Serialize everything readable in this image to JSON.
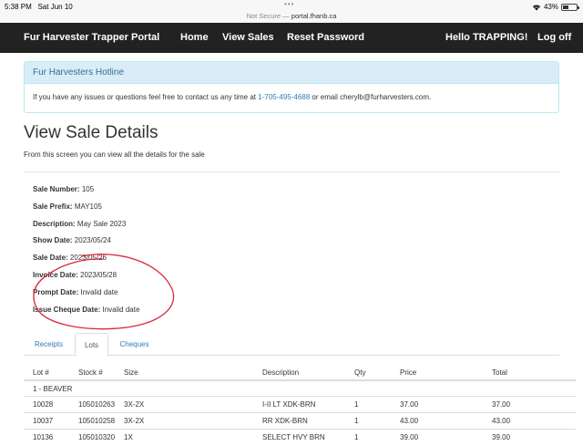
{
  "status_bar": {
    "time": "5:38 PM",
    "date": "Sat Jun 10",
    "url_prefix": "Not Secure — ",
    "url_host": "portal.fhanb.ca",
    "battery": "43%",
    "battery_level": 0.43
  },
  "navbar": {
    "brand": "Fur Harvester Trapper Portal",
    "home": "Home",
    "view_sales": "View Sales",
    "reset_password": "Reset Password",
    "greeting": "Hello TRAPPING!",
    "logoff": "Log off"
  },
  "hotline": {
    "title": "Fur Harvesters Hotline",
    "text_before": "If you have any issues or questions feel free to contact us any time at ",
    "phone": "1-705-495-4688",
    "text_after": " or email cherylb@furharvesters.com."
  },
  "page": {
    "title": "View Sale Details",
    "subtitle": "From this screen you can view all the details for the sale"
  },
  "details": [
    {
      "label": "Sale Number:",
      "value": "105"
    },
    {
      "label": "Sale Prefix:",
      "value": "MAY105"
    },
    {
      "label": "Description:",
      "value": "May Sale 2023"
    },
    {
      "label": "Show Date:",
      "value": "2023/05/24"
    },
    {
      "label": "Sale Date:",
      "value": "2023/05/26"
    },
    {
      "label": "Invoice Date:",
      "value": "2023/05/28"
    },
    {
      "label": "Prompt Date:",
      "value": "Invalid date"
    },
    {
      "label": "Issue Cheque Date:",
      "value": "Invalid date"
    }
  ],
  "tabs": [
    {
      "label": "Receipts"
    },
    {
      "label": "Lots"
    },
    {
      "label": "Cheques"
    }
  ],
  "table": {
    "headers": [
      "Lot #",
      "Stock #",
      "Size",
      "Description",
      "Qty",
      "Price",
      "Total"
    ],
    "group": "1 - BEAVER",
    "rows": [
      [
        "10028",
        "105010263",
        "3X-2X",
        "I-II LT XDK-BRN",
        "1",
        "37.00",
        "37.00"
      ],
      [
        "10037",
        "105010258",
        "3X-2X",
        "RR XDK-BRN",
        "1",
        "43.00",
        "43.00"
      ],
      [
        "10136",
        "105010320",
        "1X",
        "SELECT HVY BRN",
        "1",
        "39.00",
        "39.00"
      ]
    ]
  }
}
